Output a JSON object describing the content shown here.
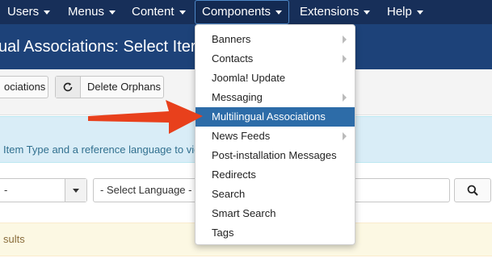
{
  "nav": {
    "items": [
      {
        "label": "Users"
      },
      {
        "label": "Menus"
      },
      {
        "label": "Content"
      },
      {
        "label": "Components"
      },
      {
        "label": "Extensions"
      },
      {
        "label": "Help"
      }
    ]
  },
  "header": {
    "title": "ual Associations: Select Iter"
  },
  "toolbar": {
    "associations_label": "ociations",
    "delete_orphans_label": "Delete Orphans"
  },
  "info": {
    "text": "Item Type and a reference language to vie"
  },
  "filters": {
    "item_type_value": "-",
    "language_value": "- Select Language -"
  },
  "warning": {
    "text": "sults"
  },
  "components_menu": {
    "items": [
      {
        "label": "Banners"
      },
      {
        "label": "Contacts"
      },
      {
        "label": "Joomla! Update"
      },
      {
        "label": "Messaging"
      },
      {
        "label": "Multilingual Associations"
      },
      {
        "label": "News Feeds"
      },
      {
        "label": "Post-installation Messages"
      },
      {
        "label": "Redirects"
      },
      {
        "label": "Search"
      },
      {
        "label": "Smart Search"
      },
      {
        "label": "Tags"
      }
    ]
  },
  "colors": {
    "navbar": "#172f59",
    "header": "#1d4279",
    "highlight": "#2d6ca8",
    "annotation_arrow": "#e8401c"
  }
}
